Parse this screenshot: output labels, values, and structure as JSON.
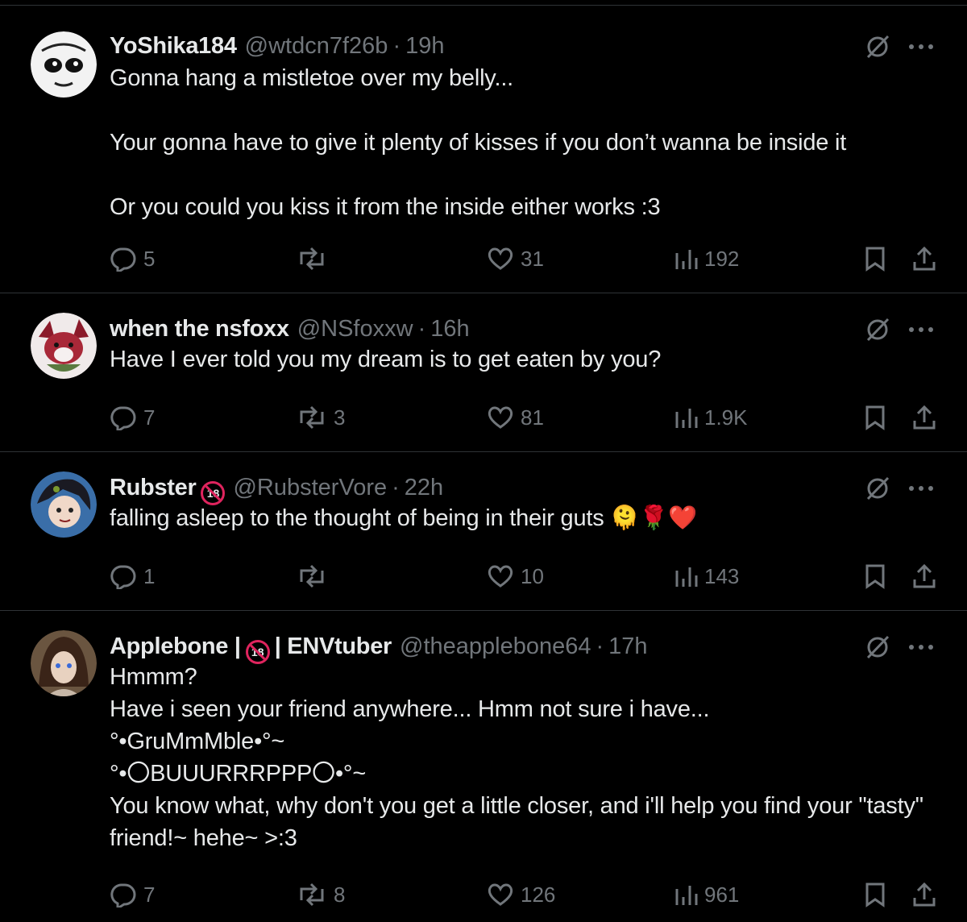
{
  "posts": [
    {
      "name": "YoShika184",
      "handle": "@wtdcn7f26b",
      "sep": "·",
      "time": "19h",
      "text": "Gonna hang a mistletoe over my belly...\n\nYour gonna have to give it plenty of kisses if you don’t wanna be inside it\n\nOr you could you kiss it from the inside either works :3",
      "replies": "5",
      "reposts": "",
      "likes": "31",
      "views": "192"
    },
    {
      "name": "when the nsfoxx",
      "handle": "@NSfoxxw",
      "sep": "·",
      "time": "16h",
      "text": "Have I ever told you my dream is to get eaten by you?",
      "replies": "7",
      "reposts": "3",
      "likes": "81",
      "views": "1.9K"
    },
    {
      "name": "Rubster",
      "badge": "18",
      "handle": "@RubsterVore",
      "sep": "·",
      "time": "22h",
      "text": "falling asleep to the thought of being in their guts 🫠🌹❤️",
      "replies": "1",
      "reposts": "",
      "likes": "10",
      "views": "143"
    },
    {
      "name": "Applebone |",
      "badge": "18",
      "name_suffix": "| ENVtuber",
      "handle": "@theapplebone64",
      "sep": "·",
      "time": "17h",
      "text": "Hmmm?\nHave i seen your friend anywhere... Hmm not sure i have...\n°•GruMmMble•°~\n°•〇BUUURRRPPP〇•°~\nYou know what, why don't you get a little closer, and i'll help you find your \"tasty\" friend!~ hehe~ >:3",
      "replies": "7",
      "reposts": "8",
      "likes": "126",
      "views": "961"
    }
  ],
  "colors": {
    "background": "#000000",
    "text": "#e7e9ea",
    "muted": "#71767b",
    "divider": "#2f3336",
    "badge": "#e0245e"
  },
  "icons": [
    "grok-icon",
    "more-icon",
    "reply-icon",
    "repost-icon",
    "like-icon",
    "views-icon",
    "bookmark-icon",
    "share-icon"
  ]
}
